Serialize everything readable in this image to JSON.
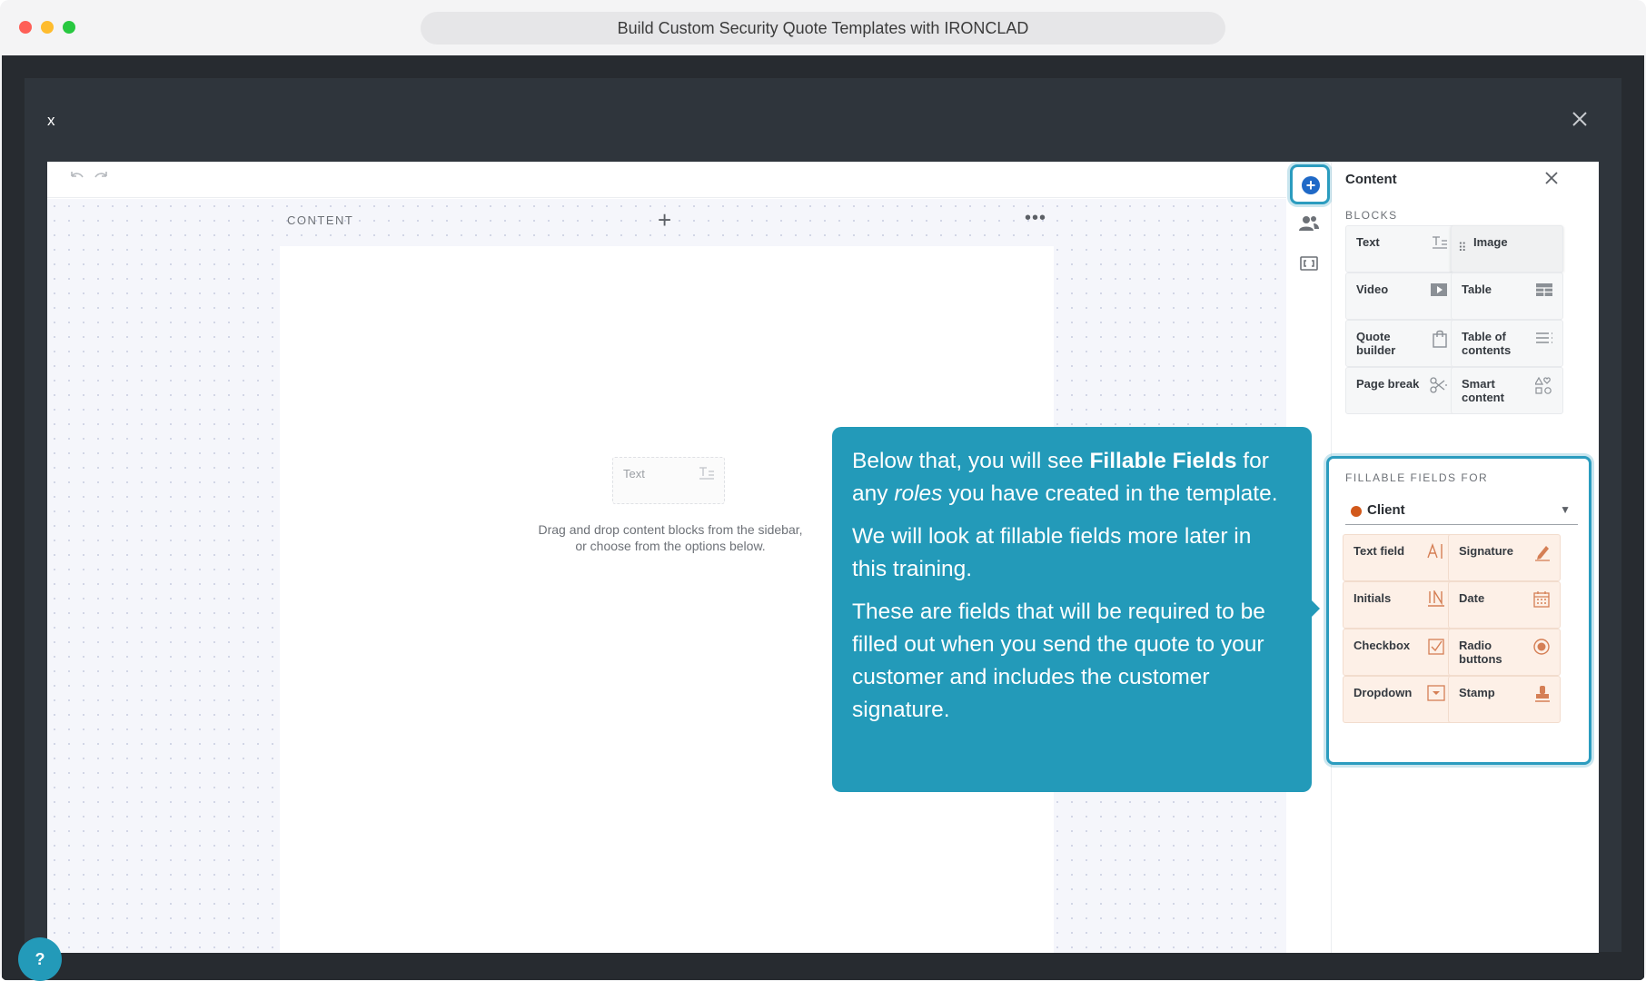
{
  "browser": {
    "title": "Build Custom Security Quote Templates with IRONCLAD"
  },
  "modal": {
    "left_label": "x",
    "close_icon": "close-icon"
  },
  "toolbar": {
    "undo_icon": "undo-icon",
    "redo_icon": "redo-icon"
  },
  "canvas": {
    "section_label": "CONTENT",
    "add_section": "+",
    "more_label": "•••",
    "ghost_block_label": "Text",
    "drop_hint_line1": "Drag and drop content blocks from the sidebar,",
    "drop_hint_line2": "or choose from the options below."
  },
  "panel": {
    "title": "Content",
    "blocks_heading": "BLOCKS",
    "blocks": [
      {
        "label": "Text",
        "icon": "text-icon"
      },
      {
        "label": "Image",
        "icon": "image-icon"
      },
      {
        "label": "Video",
        "icon": "video-icon"
      },
      {
        "label": "Table",
        "icon": "table-icon"
      },
      {
        "label": "Quote builder",
        "icon": "bag-icon"
      },
      {
        "label": "Table of contents",
        "icon": "list-icon"
      },
      {
        "label": "Page break",
        "icon": "scissors-icon"
      },
      {
        "label": "Smart content",
        "icon": "shapes-icon"
      }
    ],
    "fillable_heading": "FILLABLE FIELDS FOR",
    "role": "Client",
    "role_color": "#d2591b",
    "fields": [
      {
        "label": "Text field",
        "icon": "text-field-icon"
      },
      {
        "label": "Signature",
        "icon": "pen-icon"
      },
      {
        "label": "Initials",
        "icon": "initials-icon"
      },
      {
        "label": "Date",
        "icon": "calendar-icon"
      },
      {
        "label": "Checkbox",
        "icon": "checkbox-icon"
      },
      {
        "label": "Radio buttons",
        "icon": "radio-icon"
      },
      {
        "label": "Dropdown",
        "icon": "dropdown-icon"
      },
      {
        "label": "Stamp",
        "icon": "stamp-icon"
      }
    ]
  },
  "tooltip": {
    "p1_a": "Below that, you will see ",
    "p1_bold": "Fillable Fields",
    "p1_b": " for any ",
    "p1_italic": "roles",
    "p1_c": " you have created in the template.",
    "p2": "We will look at fillable fields more later in this training.",
    "p3": "These are fields that will be required to be filled out when you send the quote to your customer and includes the customer signature."
  },
  "help": {
    "label": "?"
  },
  "colors": {
    "accent": "#239ab9",
    "primary": "#1f69c7",
    "field_bg": "#fdf0e7"
  }
}
